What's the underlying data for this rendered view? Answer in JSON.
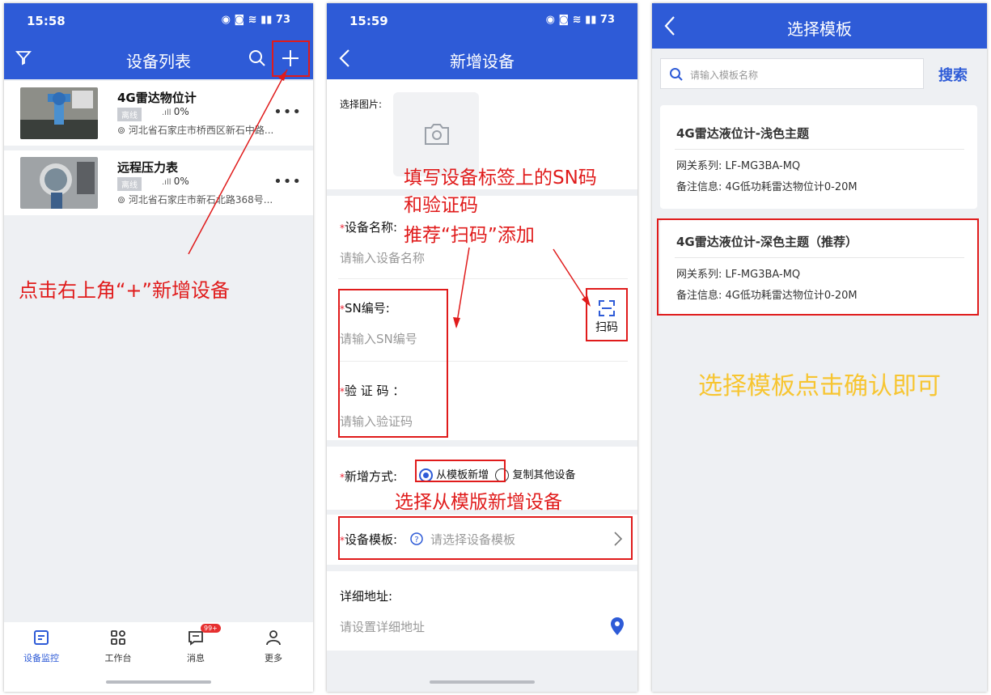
{
  "status": {
    "time1": "15:58",
    "time2": "15:59",
    "icons": "◉ ◙ ≋ ▮▮ 73"
  },
  "device_list": {
    "title": "设备列表",
    "devices": [
      {
        "name": "4G雷达物位计",
        "status": "离线",
        "signal": "0%",
        "address": "河北省石家庄市桥西区新石中路..."
      },
      {
        "name": "远程压力表",
        "status": "离线",
        "signal": "0%",
        "address": "河北省石家庄市新石北路368号..."
      }
    ],
    "annotation": "点击右上角“+”新增设备",
    "tabs": [
      {
        "label": "设备监控"
      },
      {
        "label": "工作台"
      },
      {
        "label": "消息",
        "badge": "99+"
      },
      {
        "label": "更多"
      }
    ]
  },
  "add_device": {
    "title": "新增设备",
    "image_label": "选择图片:",
    "name_label": "设备名称:",
    "name_placeholder": "请输入设备名称",
    "sn_label": "SN编号:",
    "sn_placeholder": "请输入SN编号",
    "code_label": "验 证 码 ：",
    "code_placeholder": "请输入验证码",
    "scan_label": "扫码",
    "mode_label": "新增方式:",
    "mode_option1": "从模板新增",
    "mode_option2": "复制其他设备",
    "template_label": "设备模板:",
    "template_placeholder": "请选择设备模板",
    "address_label": "详细地址:",
    "address_placeholder": "请设置详细地址",
    "annotation_sn_1": "填写设备标签上的SN码",
    "annotation_sn_2": "和验证码",
    "annotation_sn_3": "推荐“扫码”添加",
    "annotation_mode": "选择从模版新增设备"
  },
  "select_template": {
    "title": "选择模板",
    "search_placeholder": "请输入模板名称",
    "search_button": "搜索",
    "templates": [
      {
        "name": "4G雷达液位计-浅色主题",
        "gateway": "网关系列: LF-MG3BA-MQ",
        "note": "备注信息: 4G低功耗雷达物位计0-20M"
      },
      {
        "name": "4G雷达液位计-深色主题（推荐）",
        "gateway": "网关系列: LF-MG3BA-MQ",
        "note": "备注信息: 4G低功耗雷达物位计0-20M"
      }
    ],
    "annotation": "选择模板点击确认即可"
  },
  "colors": {
    "primary": "#2e5bd7",
    "annotation_red": "#e01b1b",
    "annotation_yellow": "#f7c531"
  }
}
